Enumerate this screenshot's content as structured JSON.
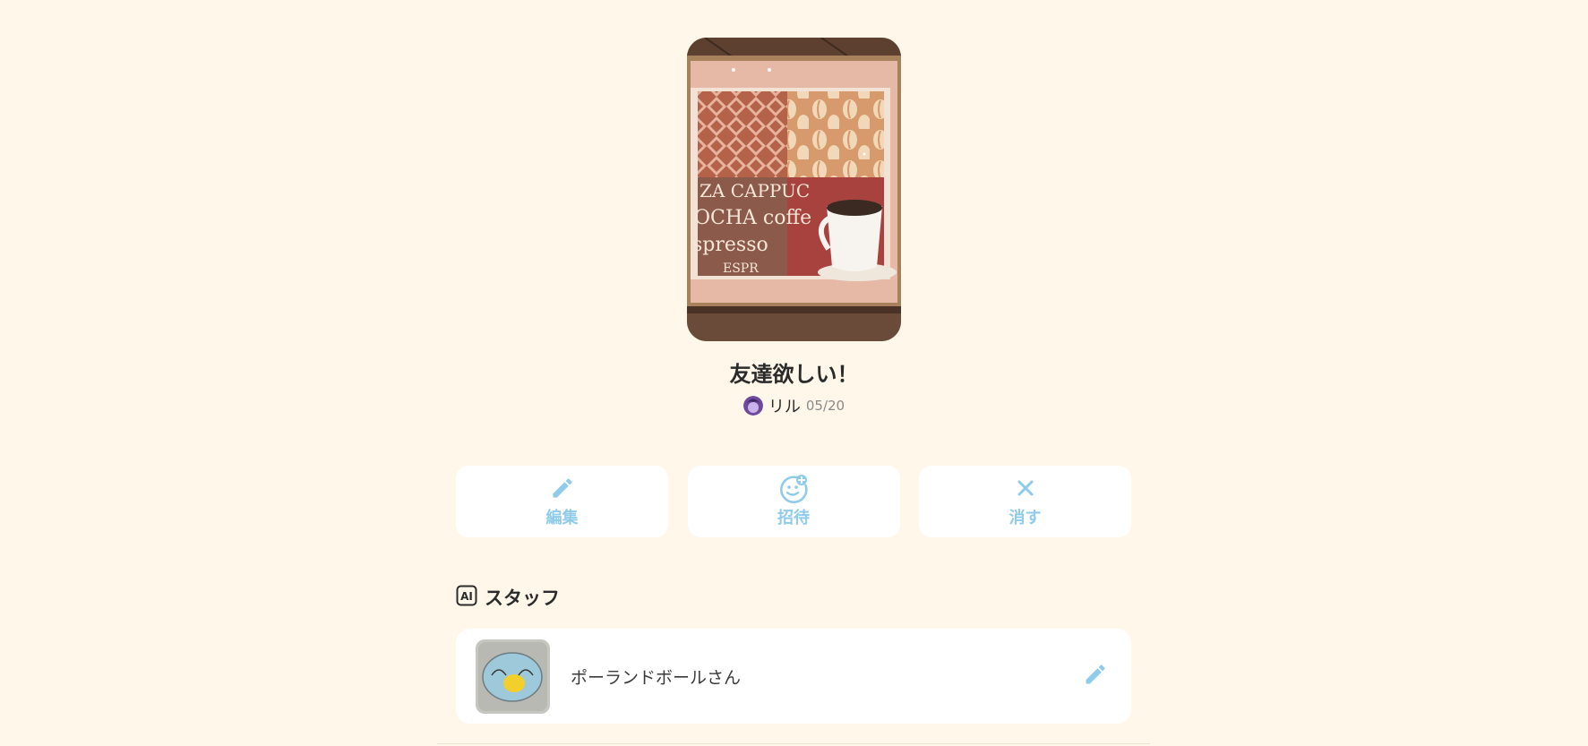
{
  "room": {
    "title": "友達欲しい！",
    "owner_name": "リル",
    "date": "05/20"
  },
  "actions": [
    {
      "label": "編集",
      "icon": "pencil-icon"
    },
    {
      "label": "招待",
      "icon": "smile-plus-icon"
    },
    {
      "label": "消す",
      "icon": "close-icon"
    }
  ],
  "staff_section": {
    "title": "スタッフ",
    "icon": "ai-icon",
    "members": [
      {
        "name": "ポーランドボールさん"
      }
    ]
  },
  "colors": {
    "background": "#fff8ea",
    "accent": "#8fcbea",
    "card": "#ffffff"
  }
}
